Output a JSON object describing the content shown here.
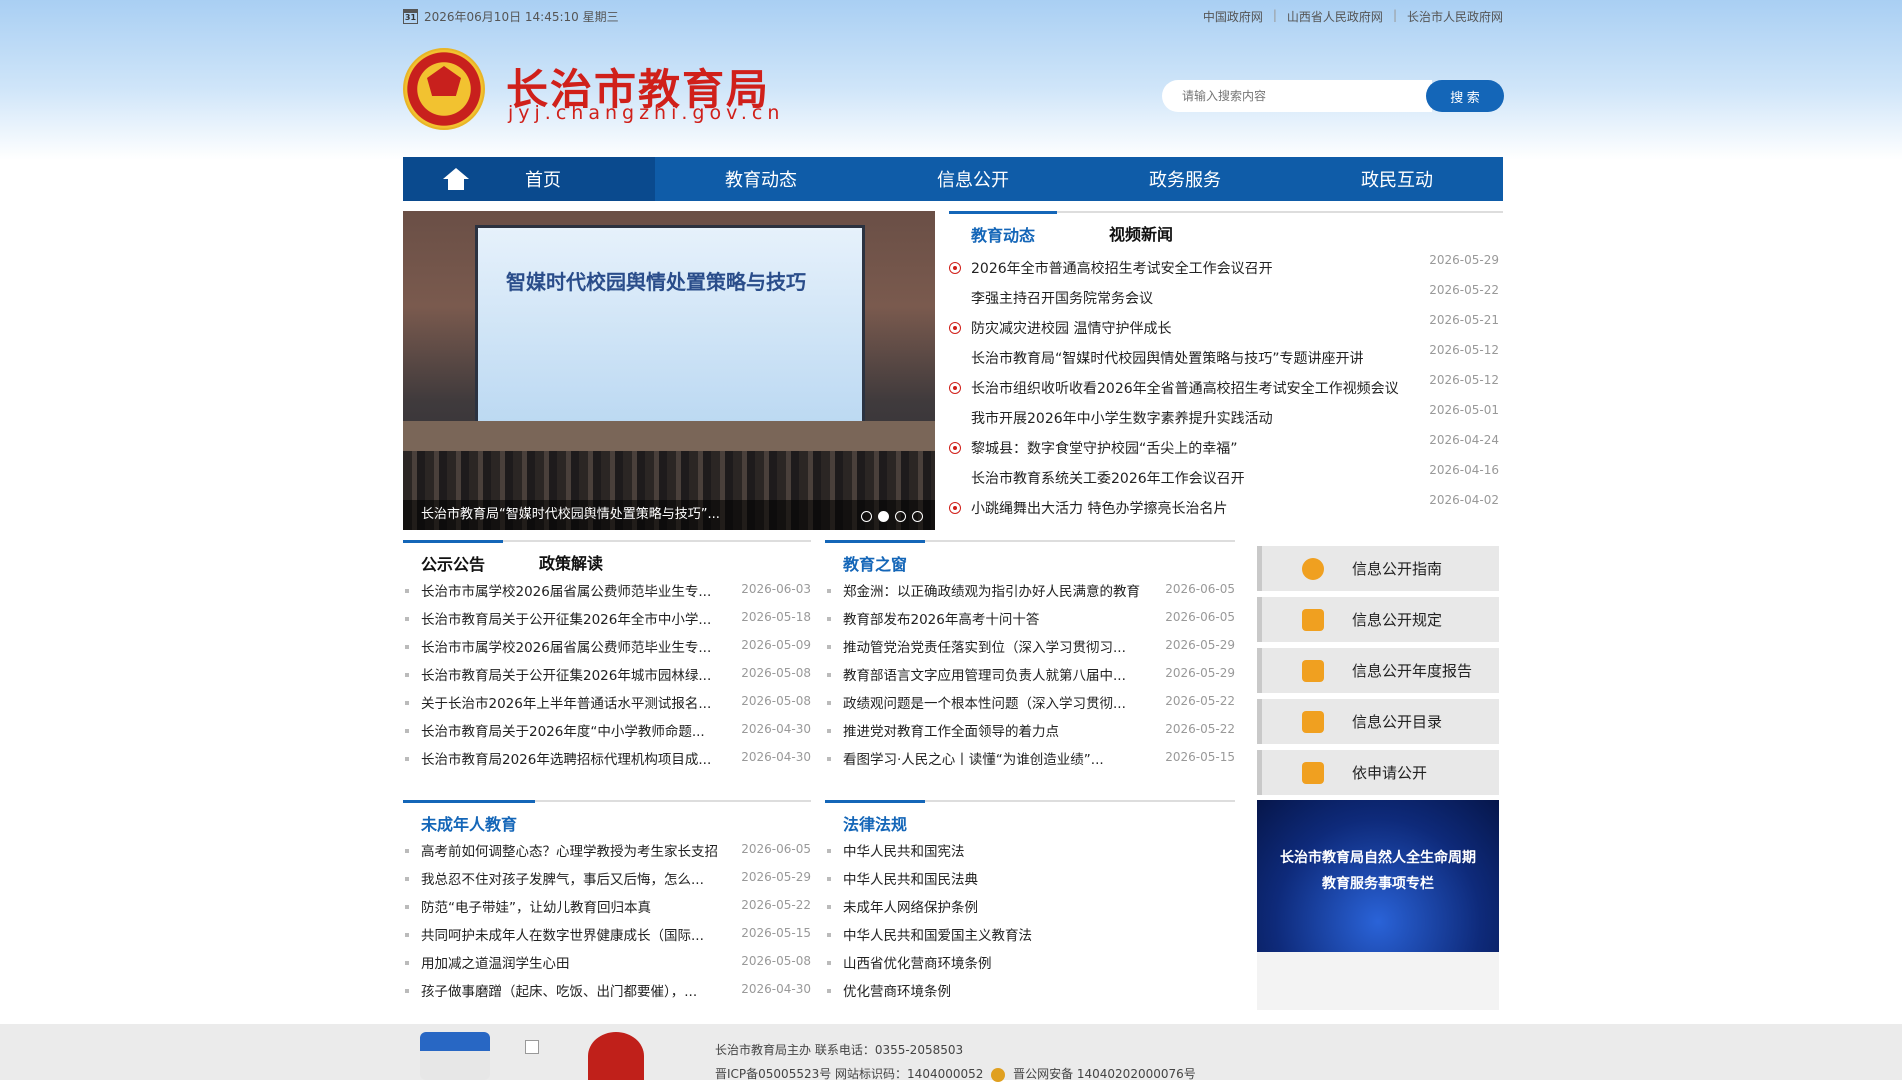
{
  "topbar": {
    "datetime": "2026年06月10日 14:45:10 星期三",
    "calendar_day": "31",
    "links": [
      "中国政府网",
      "山西省人民政府网",
      "长治市人民政府网"
    ]
  },
  "header": {
    "title_cn": "长治市教育局",
    "title_en": "jyj.changzhi.gov.cn",
    "search_placeholder": "请输入搜索内容",
    "search_button": "搜 索"
  },
  "nav": {
    "items": [
      "首页",
      "教育动态",
      "信息公开",
      "政务服务",
      "政民互动"
    ]
  },
  "slider": {
    "screen_text": "智媒时代校园舆情处置策略与技巧",
    "caption": "长治市教育局“智媒时代校园舆情处置策略与技巧”...",
    "active_index": 1,
    "dot_count": 4
  },
  "news": {
    "tabs": [
      "教育动态",
      "视频新闻"
    ],
    "items": [
      {
        "title": "2026年全市普通高校招生考试安全工作会议召开",
        "date": "2026-05-29",
        "marked": true
      },
      {
        "title": "李强主持召开国务院常务会议",
        "date": "2026-05-22",
        "marked": false
      },
      {
        "title": "防灾减灾进校园 温情守护伴成长",
        "date": "2026-05-21",
        "marked": true
      },
      {
        "title": "长治市教育局“智媒时代校园舆情处置策略与技巧”专题讲座开讲",
        "date": "2026-05-12",
        "marked": false
      },
      {
        "title": "长治市组织收听收看2026年全省普通高校招生考试安全工作视频会议",
        "date": "2026-05-12",
        "marked": true
      },
      {
        "title": "我市开展2026年中小学生数字素养提升实践活动",
        "date": "2026-05-01",
        "marked": false
      },
      {
        "title": "黎城县：数字食堂守护校园“舌尖上的幸福”",
        "date": "2026-04-24",
        "marked": true
      },
      {
        "title": "长治市教育系统关工委2026年工作会议召开",
        "date": "2026-04-16",
        "marked": false
      },
      {
        "title": "小跳绳舞出大活力 特色办学擦亮长治名片",
        "date": "2026-04-02",
        "marked": true
      }
    ]
  },
  "notice": {
    "tabs": [
      "公示公告",
      "政策解读"
    ],
    "items": [
      {
        "title": "长治市市属学校2026届省属公费师范毕业生专...",
        "date": "2026-06-03"
      },
      {
        "title": "长治市教育局关于公开征集2026年全市中小学...",
        "date": "2026-05-18"
      },
      {
        "title": "长治市市属学校2026届省属公费师范毕业生专...",
        "date": "2026-05-09"
      },
      {
        "title": "长治市教育局关于公开征集2026年城市园林绿...",
        "date": "2026-05-08"
      },
      {
        "title": "关于长治市2026年上半年普通话水平测试报名...",
        "date": "2026-05-08"
      },
      {
        "title": "长治市教育局关于2026年度“中小学教师命题...",
        "date": "2026-04-30"
      },
      {
        "title": "长治市教育局2026年选聘招标代理机构项目成...",
        "date": "2026-04-30"
      }
    ]
  },
  "window": {
    "title": "教育之窗",
    "items": [
      {
        "title": "郑金洲：以正确政绩观为指引办好人民满意的教育",
        "date": "2026-06-05"
      },
      {
        "title": "教育部发布2026年高考十问十答",
        "date": "2026-06-05"
      },
      {
        "title": "推动管党治党责任落实到位（深入学习贯彻习...",
        "date": "2026-05-29"
      },
      {
        "title": "教育部语言文字应用管理司负责人就第八届中...",
        "date": "2026-05-29"
      },
      {
        "title": "政绩观问题是一个根本性问题（深入学习贯彻...",
        "date": "2026-05-22"
      },
      {
        "title": "推进党对教育工作全面领导的着力点",
        "date": "2026-05-22"
      },
      {
        "title": "看图学习·人民之心丨读懂“为谁创造业绩”...",
        "date": "2026-05-15"
      }
    ]
  },
  "minor": {
    "title": "未成年人教育",
    "items": [
      {
        "title": "高考前如何调整心态？心理学教授为考生家长支招",
        "date": "2026-06-05"
      },
      {
        "title": "我总忍不住对孩子发脾气，事后又后悔，怎么...",
        "date": "2026-05-29"
      },
      {
        "title": "防范“电子带娃”，让幼儿教育回归本真",
        "date": "2026-05-22"
      },
      {
        "title": "共同呵护未成年人在数字世界健康成长（国际...",
        "date": "2026-05-15"
      },
      {
        "title": "用加减之道温润学生心田",
        "date": "2026-05-08"
      },
      {
        "title": "孩子做事磨蹭（起床、吃饭、出门都要催），...",
        "date": "2026-04-30"
      }
    ]
  },
  "law": {
    "title": "法律法规",
    "items": [
      {
        "title": "中华人民共和国宪法"
      },
      {
        "title": "中华人民共和国民法典"
      },
      {
        "title": "未成年人网络保护条例"
      },
      {
        "title": "中华人民共和国爱国主义教育法"
      },
      {
        "title": "山西省优化营商环境条例"
      },
      {
        "title": "优化营商环境条例"
      }
    ]
  },
  "side": {
    "buttons": [
      "信息公开指南",
      "信息公开规定",
      "信息公开年度报告",
      "信息公开目录",
      "依申请公开"
    ],
    "banner_lines": [
      "长治市教育局自然人全生命周期",
      "教育服务事项专栏"
    ]
  },
  "footer": {
    "line1": "长治市教育局主办  联系电话：0355-2058503",
    "line2_a": "晋ICP备05005523号 网站标识码：1404000052",
    "line2_b": "晋公网安备 14040202000076号"
  },
  "colors": {
    "accent": "#1466b8",
    "brand_red": "#d0201a",
    "nav_bg": "#0f5ca8"
  }
}
